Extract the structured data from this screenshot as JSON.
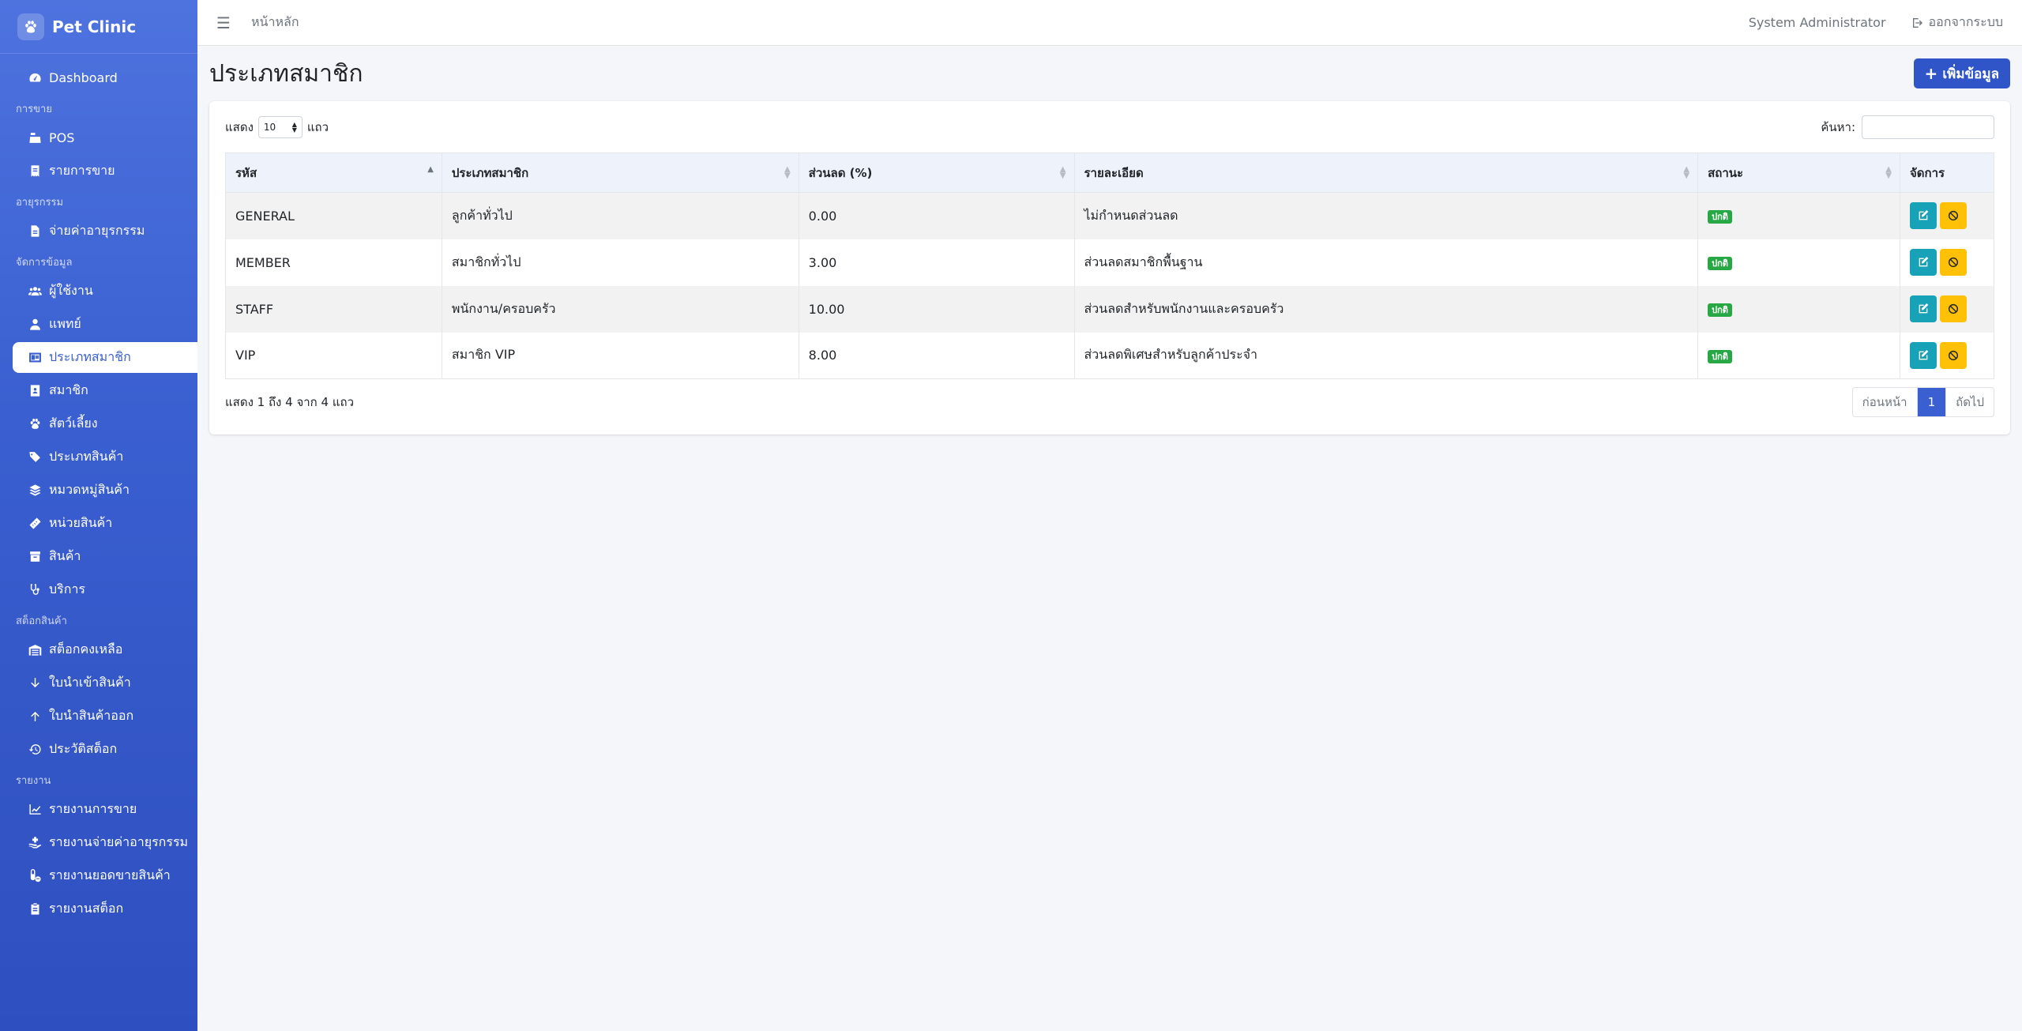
{
  "brand": {
    "name": "Pet Clinic"
  },
  "sidebar": {
    "dashboard": "Dashboard",
    "sections": {
      "sales": "การขาย",
      "surgery": "อายุรกรรม",
      "manage": "จัดการข้อมูล",
      "stock": "สต็อกสินค้า",
      "reports": "รายงาน"
    },
    "items": {
      "pos": "POS",
      "sales_list": "รายการขาย",
      "pay_surgery": "จ่ายค่าอายุรกรรม",
      "users": "ผู้ใช้งาน",
      "doctors": "แพทย์",
      "member_types": "ประเภทสมาชิก",
      "members": "สมาชิก",
      "pets": "สัตว์เลี้ยง",
      "product_types": "ประเภทสินค้า",
      "product_categories": "หมวดหมู่สินค้า",
      "product_units": "หน่วยสินค้า",
      "products": "สินค้า",
      "services": "บริการ",
      "stock_remaining": "สต็อกคงเหลือ",
      "stock_in": "ใบนำเข้าสินค้า",
      "stock_out": "ใบนำสินค้าออก",
      "stock_history": "ประวัติสต็อก",
      "report_sales": "รายงานการขาย",
      "report_surgery": "รายงานจ่ายค่าอายุรกรรม",
      "report_product_sales": "รายงานยอดขายสินค้า",
      "report_stock": "รายงานสต็อก"
    }
  },
  "topbar": {
    "home": "หน้าหลัก",
    "user": "System Administrator",
    "logout": "ออกจากระบบ"
  },
  "page": {
    "title": "ประเภทสมาชิก",
    "add_button": "เพิ่มข้อมูล"
  },
  "table_controls": {
    "show_prefix": "แสดง",
    "page_length": "10",
    "show_suffix": "แถว",
    "search_label": "ค้นหา:"
  },
  "table": {
    "columns": [
      "รหัส",
      "ประเภทสมาชิก",
      "ส่วนลด (%)",
      "รายละเอียด",
      "สถานะ",
      "จัดการ"
    ],
    "rows": [
      {
        "code": "GENERAL",
        "type": "ลูกค้าทั่วไป",
        "discount": "0.00",
        "detail": "ไม่กำหนดส่วนลด",
        "status": "ปกติ"
      },
      {
        "code": "MEMBER",
        "type": "สมาชิกทั่วไป",
        "discount": "3.00",
        "detail": "ส่วนลดสมาชิกพื้นฐาน",
        "status": "ปกติ"
      },
      {
        "code": "STAFF",
        "type": "พนักงาน/ครอบครัว",
        "discount": "10.00",
        "detail": "ส่วนลดสำหรับพนักงานและครอบครัว",
        "status": "ปกติ"
      },
      {
        "code": "VIP",
        "type": "สมาชิก VIP",
        "discount": "8.00",
        "detail": "ส่วนลดพิเศษสำหรับลูกค้าประจำ",
        "status": "ปกติ"
      }
    ]
  },
  "footer": {
    "info": "แสดง 1 ถึง 4 จาก 4 แถว",
    "prev": "ก่อนหน้า",
    "current_page": "1",
    "next": "ถัดไป"
  },
  "colors": {
    "sidebar": "#3a5fd0",
    "primary": "#2f55c8",
    "edit": "#17a2b8",
    "disable": "#ffc107",
    "status": "#28a745"
  }
}
